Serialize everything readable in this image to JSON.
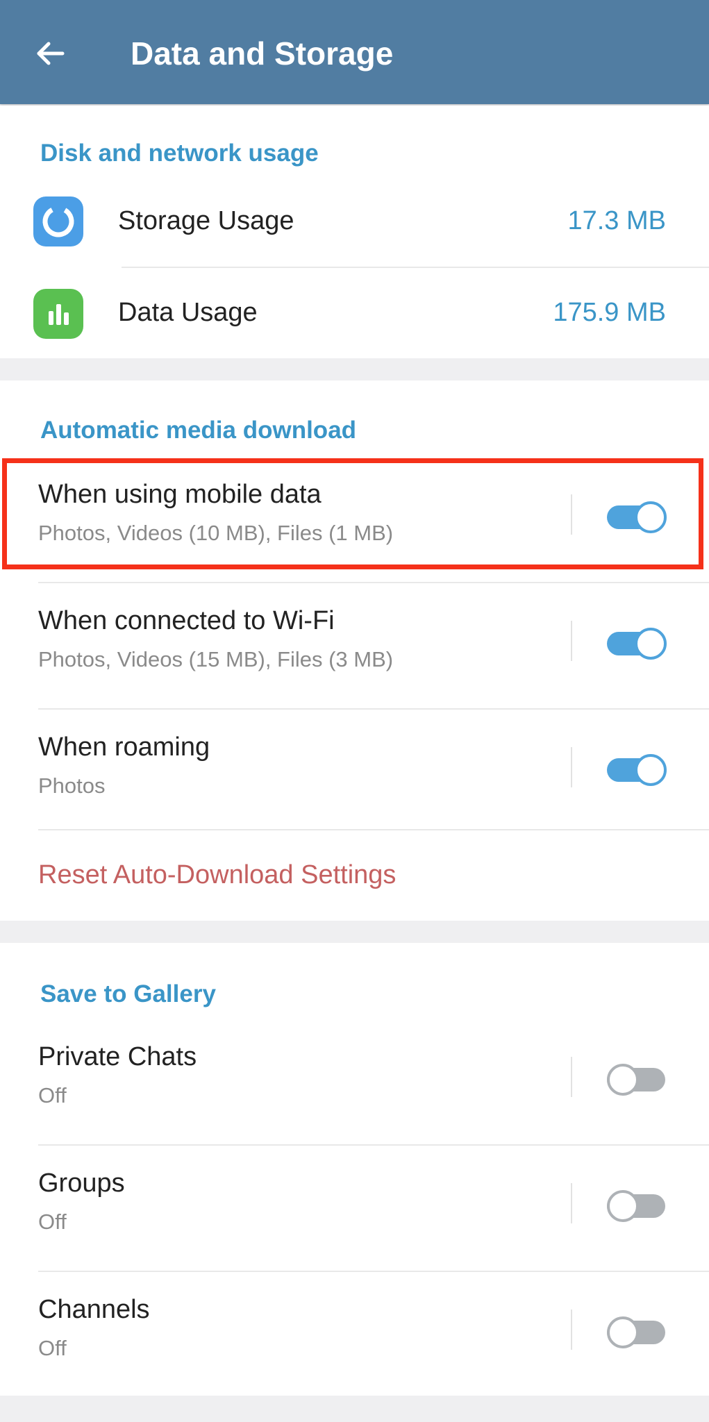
{
  "header": {
    "title": "Data and Storage",
    "back_icon": "arrow-left-icon"
  },
  "colors": {
    "appbar": "#517da2",
    "accent": "#3a95c7",
    "toggle_on": "#4fa3dc",
    "toggle_off": "#aeb2b6",
    "destructive": "#c46060",
    "highlight": "#f5311a",
    "storage_icon_bg": "#4b9ee6",
    "data_icon_bg": "#5ac051"
  },
  "disk_section": {
    "header": "Disk and network usage",
    "items": [
      {
        "label": "Storage Usage",
        "value": "17.3 MB",
        "icon": "storage-pie-icon"
      },
      {
        "label": "Data Usage",
        "value": "175.9 MB",
        "icon": "bar-chart-icon"
      }
    ]
  },
  "auto_download": {
    "header": "Automatic media download",
    "items": [
      {
        "title": "When using mobile data",
        "subtitle": "Photos, Videos (10 MB), Files (1 MB)",
        "enabled": true
      },
      {
        "title": "When connected to Wi-Fi",
        "subtitle": "Photos, Videos (15 MB), Files (3 MB)",
        "enabled": true
      },
      {
        "title": "When roaming",
        "subtitle": "Photos",
        "enabled": true
      }
    ],
    "reset_label": "Reset Auto-Download Settings"
  },
  "gallery": {
    "header": "Save to Gallery",
    "items": [
      {
        "title": "Private Chats",
        "subtitle": "Off",
        "enabled": false
      },
      {
        "title": "Groups",
        "subtitle": "Off",
        "enabled": false
      },
      {
        "title": "Channels",
        "subtitle": "Off",
        "enabled": false
      }
    ]
  }
}
